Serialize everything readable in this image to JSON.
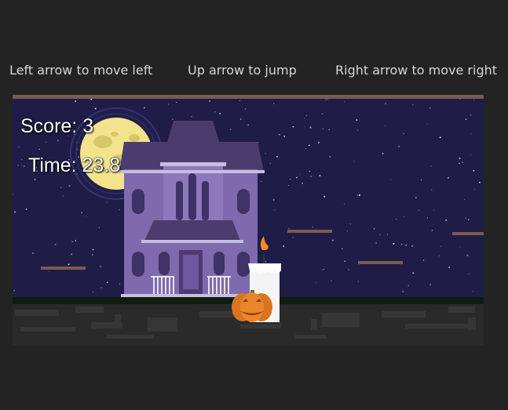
{
  "instructions": {
    "left": "Left arrow to move left",
    "jump": "Up arrow to jump",
    "right": "Right arrow to move right"
  },
  "hud": {
    "score_label": "Score: 3",
    "time_label": "Time: 23.8"
  },
  "scene": {
    "night_sky_color": "#1f1d47",
    "moon_color": "#f3e38c",
    "platform_color": "#7a5c4d",
    "ground_color": "#0f1d0f",
    "house_color": "#7e6aad",
    "house_roof_color": "#4c3c6e",
    "pumpkin_color": "#e9852b",
    "candle_color": "#f4f4f4",
    "flame_color": "#f58a1f",
    "player_icon": "pumpkin-icon",
    "candle_icon": "candle-icon",
    "moon_icon": "moon-icon",
    "house_icon": "haunted-house-icon"
  }
}
